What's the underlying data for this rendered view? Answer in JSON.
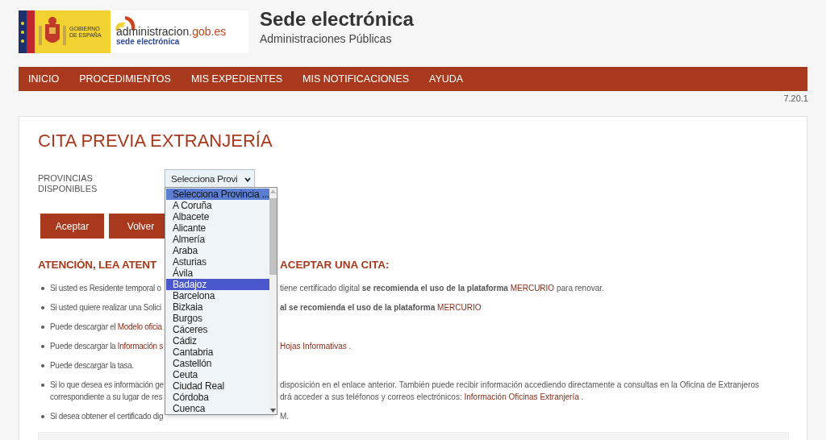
{
  "header": {
    "logo_gov": {
      "line1": "GOBIERNO",
      "line2": "DE ESPAÑA"
    },
    "logo_admin": {
      "name": "administracion",
      "domain": ".gob.es",
      "sub": "sede electrónica"
    },
    "title": "Sede electrónica",
    "subtitle": "Administraciones Públicas"
  },
  "nav": [
    "INICIO",
    "PROCEDIMIENTOS",
    "MIS EXPEDIENTES",
    "MIS NOTIFICACIONES",
    "AYUDA"
  ],
  "version": "7.20.1",
  "page_title": "CITA PREVIA EXTRANJERÍA",
  "form": {
    "label": "PROVINCIAS DISPONIBLES",
    "select_value": "Selecciona Provi",
    "options": [
      {
        "label": "Selecciona Provincia ...",
        "selected": false,
        "highlighted": true
      },
      {
        "label": "A Coruña",
        "selected": false,
        "highlighted": false
      },
      {
        "label": "Albacete",
        "selected": false,
        "highlighted": false
      },
      {
        "label": "Alicante",
        "selected": false,
        "highlighted": false
      },
      {
        "label": "Almería",
        "selected": false,
        "highlighted": false
      },
      {
        "label": "Araba",
        "selected": false,
        "highlighted": false
      },
      {
        "label": "Asturias",
        "selected": false,
        "highlighted": false
      },
      {
        "label": "Ávila",
        "selected": false,
        "highlighted": false
      },
      {
        "label": "Badajoz",
        "selected": true,
        "highlighted": false
      },
      {
        "label": "Barcelona",
        "selected": false,
        "highlighted": false
      },
      {
        "label": "Bizkaia",
        "selected": false,
        "highlighted": false
      },
      {
        "label": "Burgos",
        "selected": false,
        "highlighted": false
      },
      {
        "label": "Cáceres",
        "selected": false,
        "highlighted": false
      },
      {
        "label": "Cádiz",
        "selected": false,
        "highlighted": false
      },
      {
        "label": "Cantabria",
        "selected": false,
        "highlighted": false
      },
      {
        "label": "Castellón",
        "selected": false,
        "highlighted": false
      },
      {
        "label": "Ceuta",
        "selected": false,
        "highlighted": false
      },
      {
        "label": "Ciudad Real",
        "selected": false,
        "highlighted": false
      },
      {
        "label": "Córdoba",
        "selected": false,
        "highlighted": false
      },
      {
        "label": "Cuenca",
        "selected": false,
        "highlighted": false
      }
    ]
  },
  "buttons": [
    "Aceptar",
    "Volver"
  ],
  "notice_heading": {
    "left": "ATENCIÓN, LEA ATENT",
    "right": "ACEPTAR UNA CITA:"
  },
  "bullets": [
    {
      "lines": [
        {
          "left": [
            {
              "kind": "plain",
              "text": "Si usted es Residente temporal o"
            }
          ],
          "right": [
            {
              "kind": "plain",
              "text": "tiene certificado digital **se recomienda el uso de la plataforma**"
            },
            {
              "kind": "link",
              "text": "MERCURIO"
            },
            {
              "kind": "plain",
              "text": "para renovar."
            }
          ]
        }
      ]
    },
    {
      "lines": [
        {
          "left": [
            {
              "kind": "plain",
              "text": "Si usted quiere realizar una Solici"
            }
          ],
          "right": [
            {
              "kind": "plain",
              "text": "**al se recomienda el uso de la plataforma**"
            },
            {
              "kind": "link",
              "text": "MERCURIO"
            }
          ]
        }
      ]
    },
    {
      "lines": [
        {
          "left": [
            {
              "kind": "plain",
              "text": "Puede descargar el"
            },
            {
              "kind": "link",
              "text": "Modelo oficia"
            }
          ]
        }
      ]
    },
    {
      "lines": [
        {
          "left": [
            {
              "kind": "plain",
              "text": "Puede descargar la"
            },
            {
              "kind": "link",
              "text": "Información s"
            }
          ],
          "right": [
            {
              "kind": "link",
              "text": "Hojas Informativas"
            },
            {
              "kind": "plain",
              "text": "."
            }
          ]
        }
      ]
    },
    {
      "lines": [
        {
          "left": [
            {
              "kind": "plain",
              "text": "Puede descargar la tasa."
            }
          ]
        }
      ]
    },
    {
      "lines": [
        {
          "left": [
            {
              "kind": "plain",
              "text": "Si lo que desea es información ge"
            }
          ],
          "right": [
            {
              "kind": "plain",
              "text": "disposición en el enlace anterior. También puede recibir información accediendo directamente a consultas en la Oficina de Extranjeros"
            }
          ]
        },
        {
          "left": [
            {
              "kind": "plain",
              "text": "correspondiente a su lugar de res"
            }
          ],
          "right": [
            {
              "kind": "plain",
              "text": "drá acceder a sus teléfonos y correos electrónicos:"
            },
            {
              "kind": "link",
              "text": "Información Oficinas Extranjería"
            },
            {
              "kind": "plain",
              "text": "."
            }
          ]
        }
      ]
    },
    {
      "lines": [
        {
          "left": [
            {
              "kind": "plain",
              "text": "Si desea obtener el certificado dig"
            }
          ],
          "right": [
            {
              "kind": "plain",
              "text": "M."
            }
          ]
        }
      ]
    }
  ]
}
